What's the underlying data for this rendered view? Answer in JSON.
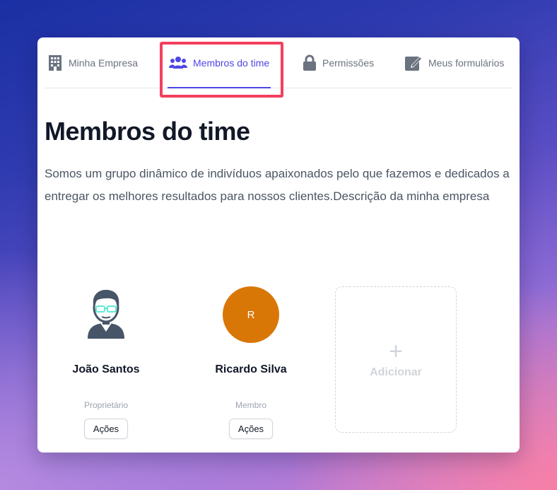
{
  "tabs": [
    {
      "label": "Minha Empresa",
      "icon": "building-icon",
      "active": false
    },
    {
      "label": "Membros do time",
      "icon": "users-icon",
      "active": true
    },
    {
      "label": "Permissões",
      "icon": "lock-icon",
      "active": false
    },
    {
      "label": "Meus formulários",
      "icon": "edit-icon",
      "active": false
    }
  ],
  "page": {
    "title": "Membros do time",
    "description": "Somos um grupo dinâmico de indivíduos apaixonados pelo que fazemos e dedicados a entregar os melhores resultados para nossos clientes.Descrição da minha empresa"
  },
  "members": [
    {
      "name": "João Santos",
      "role": "Proprietário",
      "action_label": "Ações",
      "avatar": "user-illustration-icon"
    },
    {
      "name": "Ricardo Silva",
      "role": "Membro",
      "action_label": "Ações",
      "avatar_initial": "R"
    }
  ],
  "add_member": {
    "plus": "+",
    "label": "Adicionar"
  },
  "colors": {
    "accent": "#4f46e5",
    "highlight": "#f43f5e",
    "avatar_bg": "#d97706",
    "title": "#111827",
    "muted": "#6b7280"
  }
}
